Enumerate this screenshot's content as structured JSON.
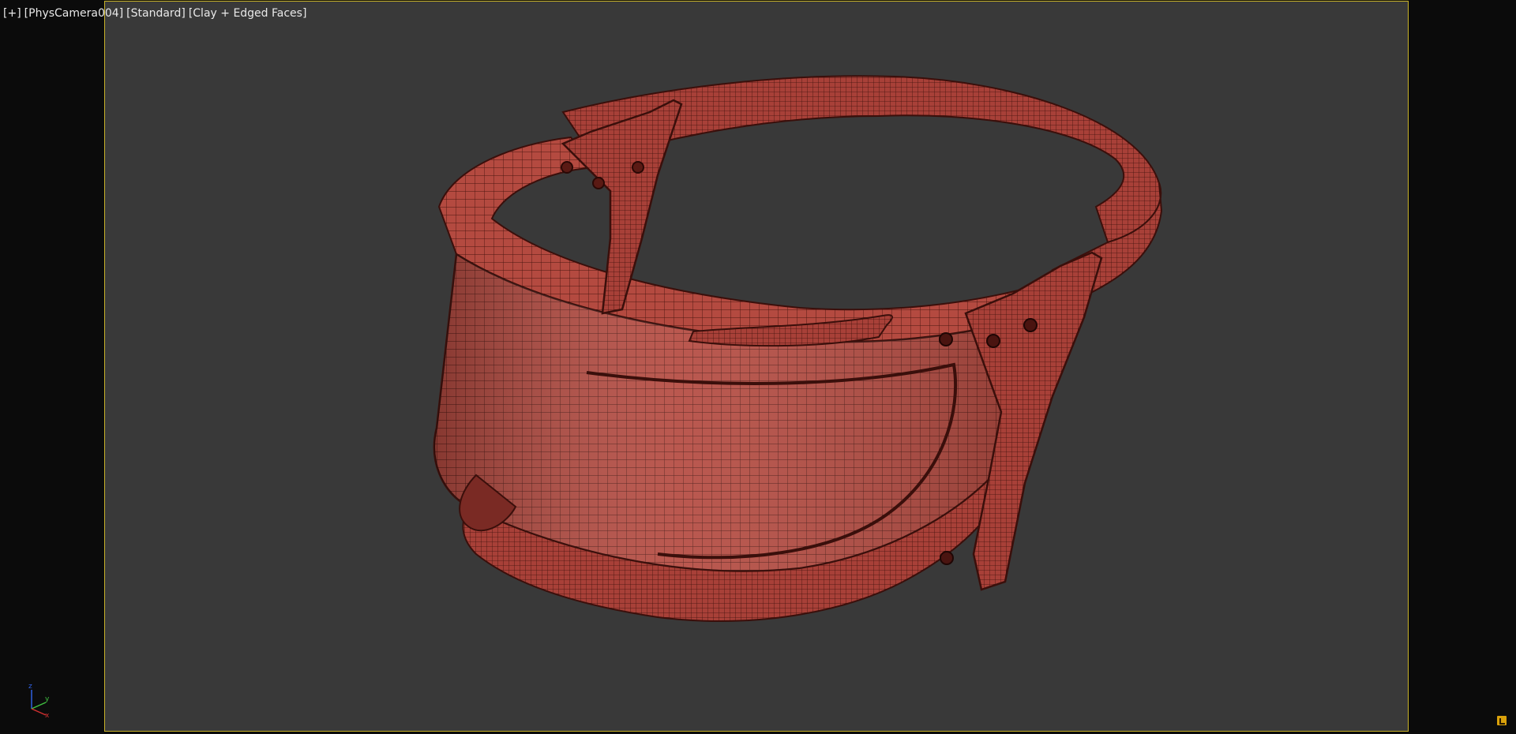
{
  "viewport": {
    "label_plus": "+",
    "label_camera": "PhysCamera004",
    "label_shading_mode": "Standard",
    "label_display_mode": "Clay + Edged Faces"
  },
  "axis_gizmo": {
    "z_label": "z",
    "y_label": "y",
    "x_label": "x"
  },
  "colors": {
    "background": "#0b0b0b",
    "viewport_bg": "#393939",
    "frame_border": "#c8b22a",
    "model_fill": "#b44a40",
    "wire": "#4a1510",
    "axis_x": "#d03030",
    "axis_y": "#40c040",
    "axis_z": "#3060e0",
    "corner_icon": "#d9a10b"
  },
  "icons": {
    "axis": "axis-tripod-icon",
    "corner": "viewport-toggle-icon"
  }
}
